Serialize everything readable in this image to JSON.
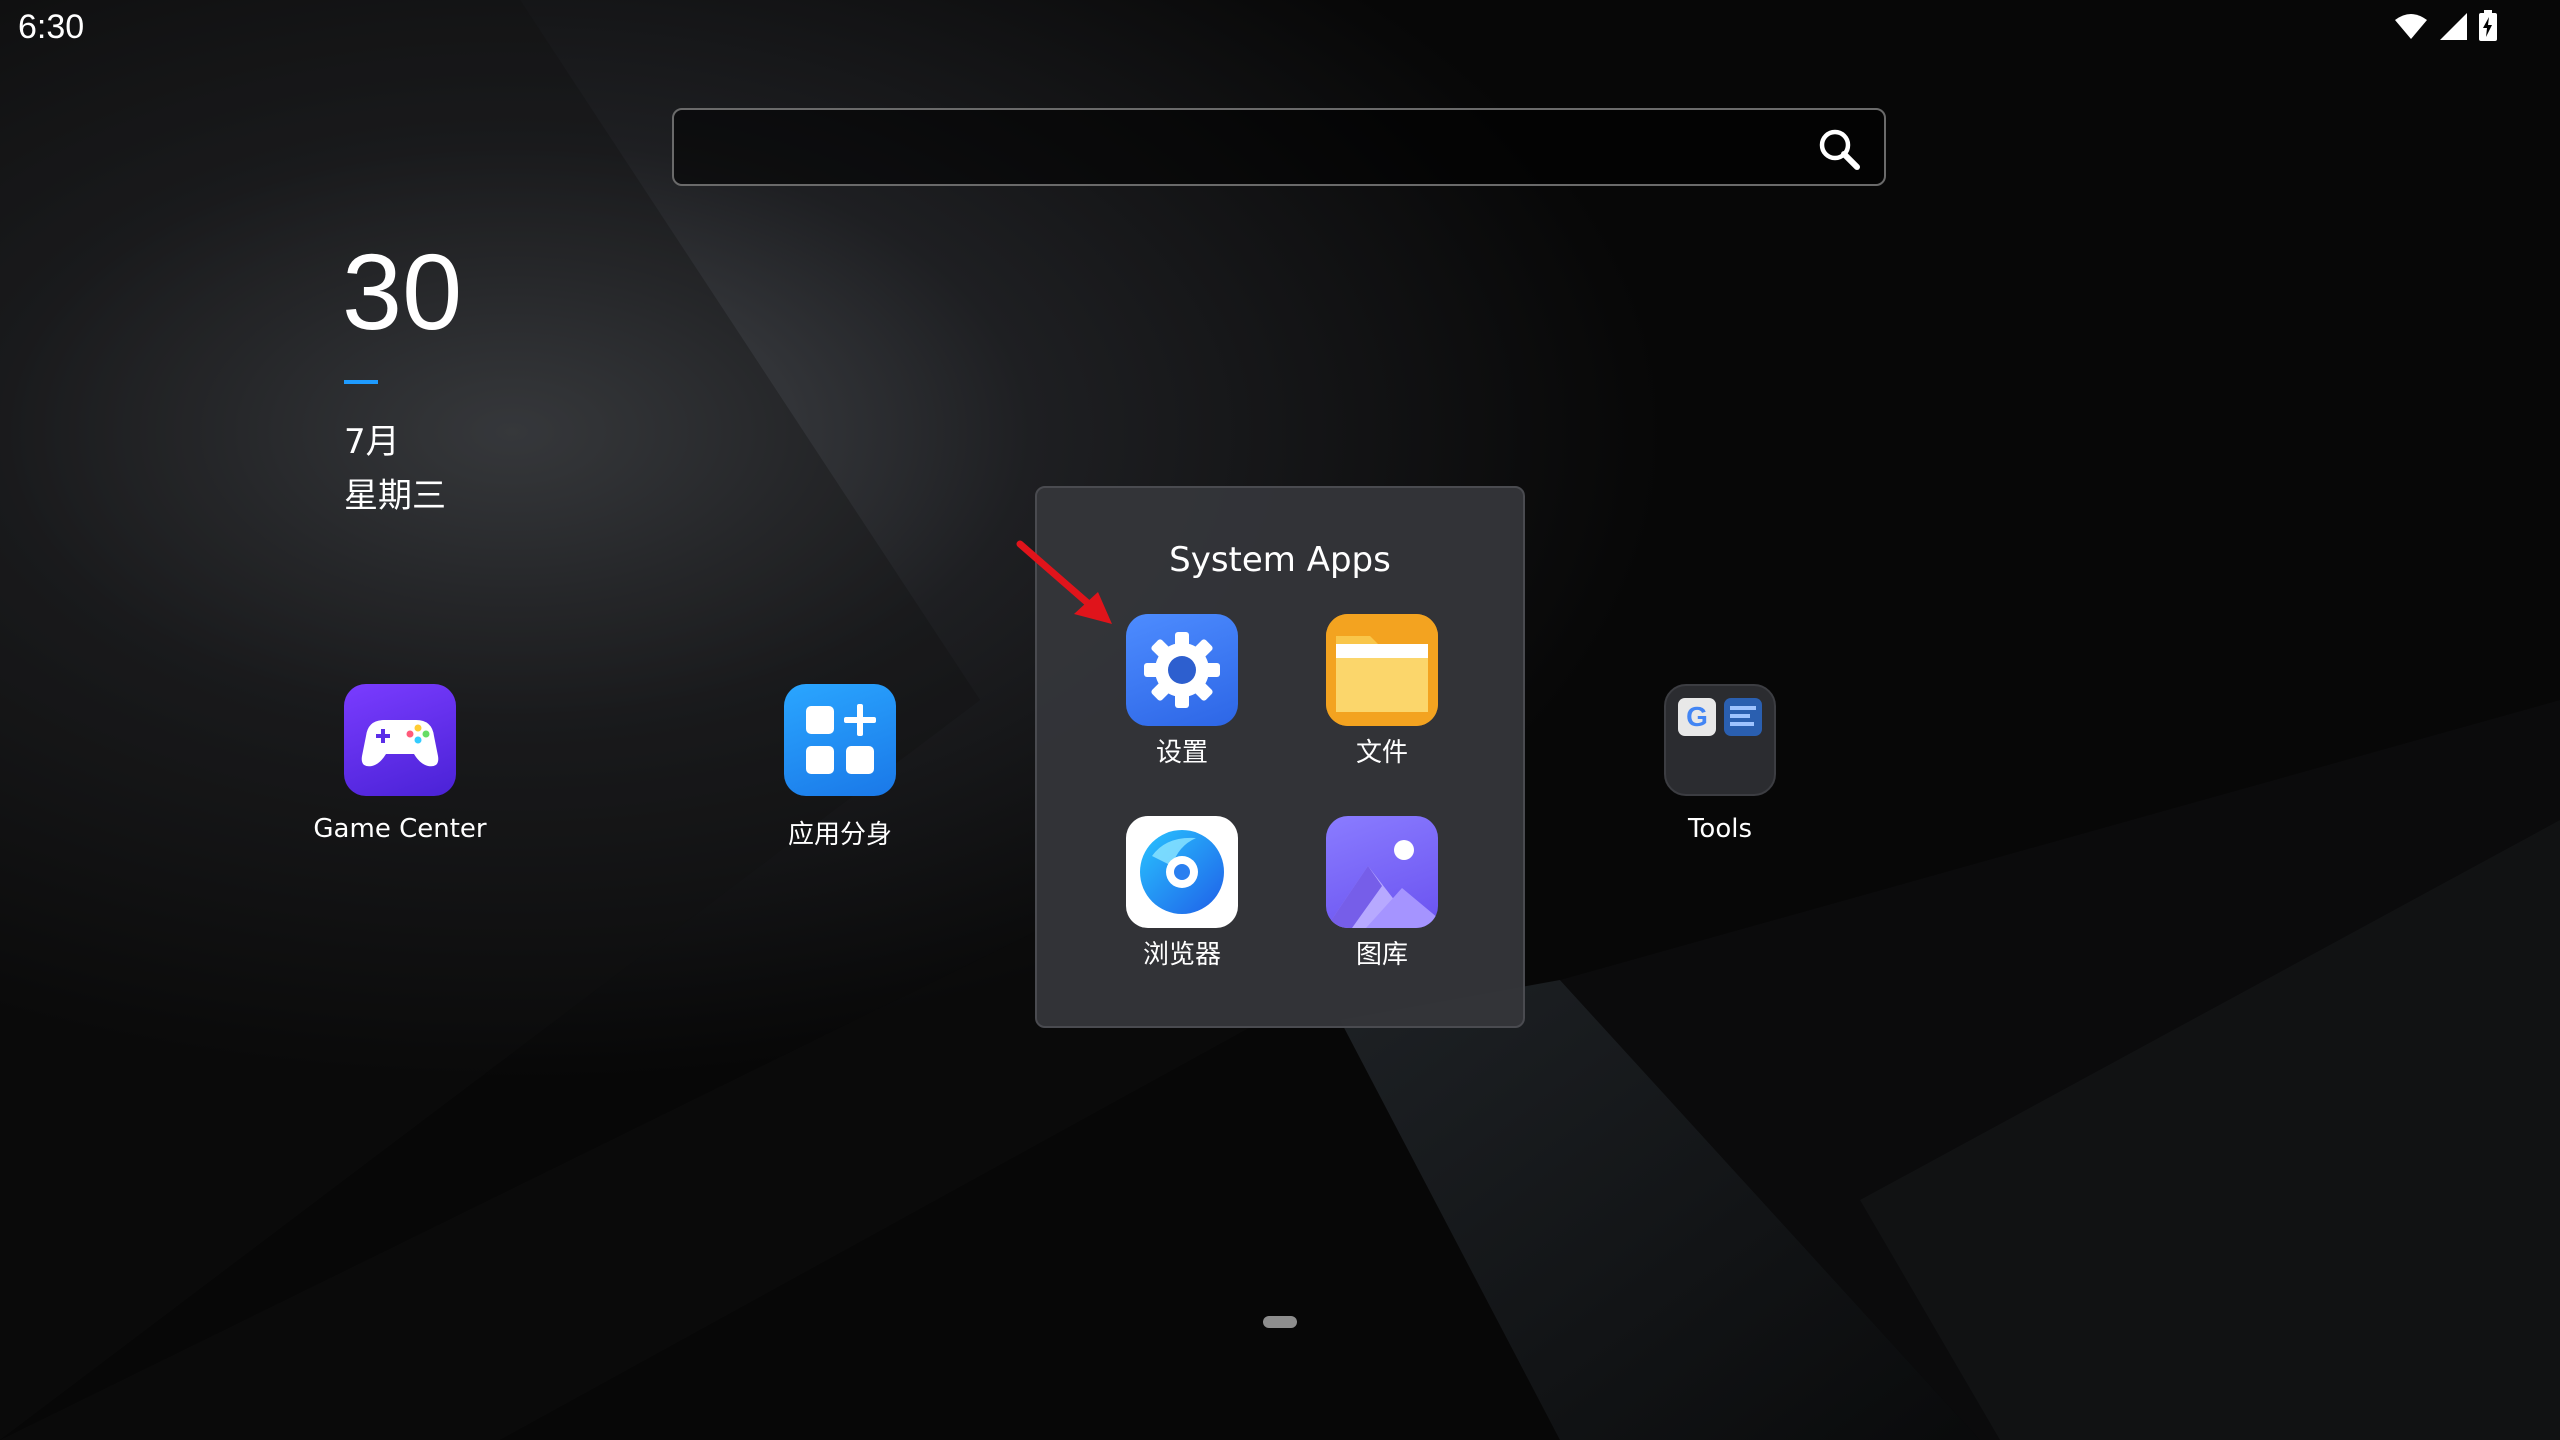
{
  "status_bar": {
    "time": "6:30",
    "icons": [
      "wifi-icon",
      "cellular-signal-icon",
      "battery-charging-icon"
    ]
  },
  "search": {
    "placeholder": "",
    "icon": "search-icon"
  },
  "date_widget": {
    "day": "30",
    "month": "7月",
    "weekday": "星期三",
    "accent_color": "#1e9bff"
  },
  "home_apps": [
    {
      "label": "Game Center",
      "icon": "game-controller-icon",
      "color": "#5b2ee8"
    },
    {
      "label": "应用分身",
      "icon": "app-clone-icon",
      "color": "#1f8cf2"
    },
    {
      "label": "Tools",
      "icon": "folder-icon",
      "color": "#2b2c30"
    }
  ],
  "folder": {
    "title": "System Apps",
    "apps": [
      {
        "label": "设置",
        "icon": "settings-gear-icon",
        "color": "#3d7cf0"
      },
      {
        "label": "文件",
        "icon": "file-folder-icon",
        "color": "#f5a623"
      },
      {
        "label": "浏览器",
        "icon": "browser-icon",
        "color": "#ffffff"
      },
      {
        "label": "图库",
        "icon": "gallery-icon",
        "color": "#7b6cf5"
      }
    ]
  },
  "annotation": {
    "type": "arrow",
    "color": "#e0141b",
    "target": "设置"
  }
}
